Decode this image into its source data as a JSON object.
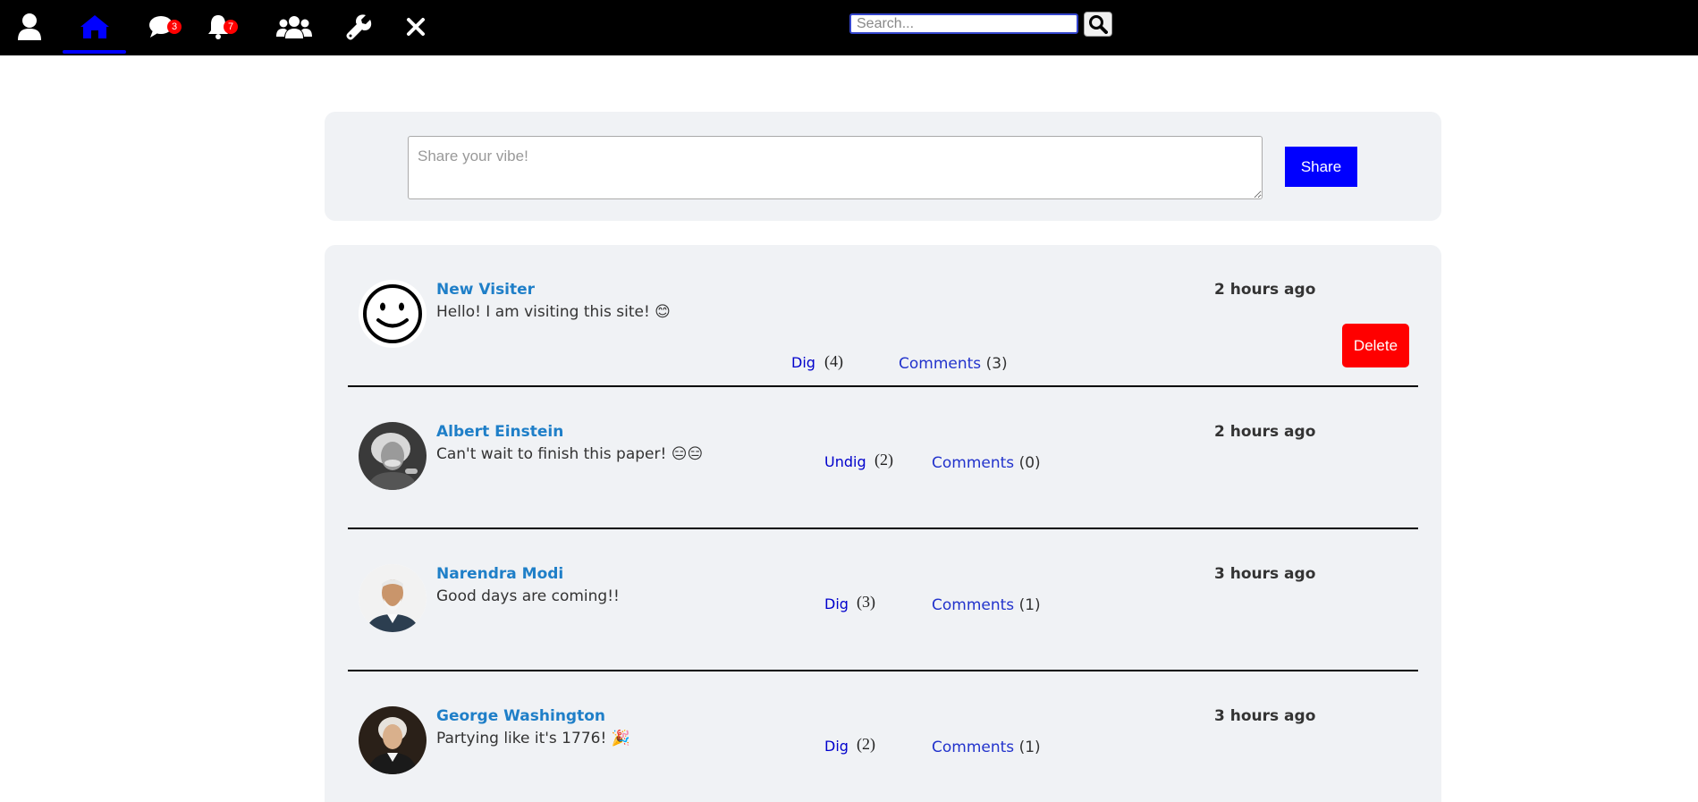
{
  "navbar": {
    "icons": [
      "user-icon",
      "home-icon",
      "chat-icon",
      "bell-icon",
      "users-icon",
      "wrench-icon",
      "close-icon"
    ],
    "active_item": "home",
    "active_color": "#0000ff",
    "chat_badge": "3",
    "notifications_badge": "7",
    "badge_color": "#ff0000",
    "search_placeholder": "Search..."
  },
  "composer": {
    "placeholder": "Share your vibe!",
    "share_label": "Share",
    "button_color": "#0000ff"
  },
  "posts": [
    {
      "author": "New Visiter",
      "text": "Hello! I am visiting this site! 😊",
      "time": "2 hours ago",
      "dig_label": "Dig",
      "dig_count": "(4)",
      "comments_label": "Comments",
      "comments_count": "(3)",
      "delete_label": "Delete",
      "avatar": "smiley-avatar"
    },
    {
      "author": "Albert Einstein",
      "text": "Can't wait to finish this paper! 😑😑",
      "time": "2 hours ago",
      "dig_label": "Undig",
      "dig_count": "(2)",
      "comments_label": "Comments",
      "comments_count": "(0)",
      "avatar": "einstein-photo"
    },
    {
      "author": "Narendra Modi",
      "text": "Good days are coming!!",
      "time": "3 hours ago",
      "dig_label": "Dig",
      "dig_count": "(3)",
      "comments_label": "Comments",
      "comments_count": "(1)",
      "avatar": "modi-photo"
    },
    {
      "author": "George Washington",
      "text": "Partying like it's 1776! 🎉",
      "time": "3 hours ago",
      "dig_label": "Dig",
      "dig_count": "(2)",
      "comments_label": "Comments",
      "comments_count": "(1)",
      "avatar": "washington-portrait"
    }
  ],
  "colors": {
    "author_link": "#1f7fc8",
    "delete_button": "#ff0000",
    "panel_background": "#f0f2f5"
  }
}
